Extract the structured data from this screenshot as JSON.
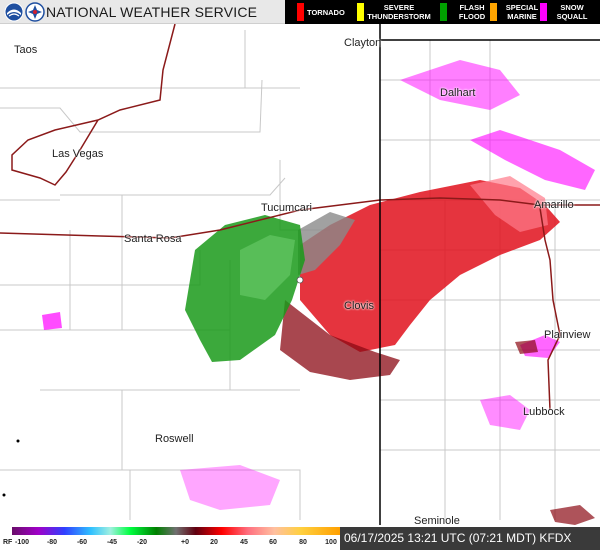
{
  "header": {
    "agency": "NATIONAL WEATHER SERVICE",
    "warnings": [
      {
        "label": "TORNADO",
        "color": "#ff0000"
      },
      {
        "label": "SEVERE THUNDERSTORM",
        "color": "#ffff00"
      },
      {
        "label": "FLASH FLOOD",
        "color": "#00a000"
      },
      {
        "label": "SPECIAL MARINE",
        "color": "#ffa500"
      },
      {
        "label": "SNOW SQUALL",
        "color": "#ff00ff"
      }
    ]
  },
  "cities": {
    "taos": "Taos",
    "clayton": "Clayton",
    "dalhart": "Dalhart",
    "las_vegas": "Las Vegas",
    "tucumcari": "Tucumcari",
    "amarillo": "Amarillo",
    "santa_rosa": "Santa Rosa",
    "clovis": "Clovis",
    "plainview": "Plainview",
    "lubbock": "Lubbock",
    "roswell": "Roswell",
    "seminole": "Seminole"
  },
  "scale": {
    "product": "RF",
    "ticks": [
      "-100",
      "-80",
      "-60",
      "-45",
      "-20",
      "+0",
      "20",
      "45",
      "60",
      "80",
      "100"
    ]
  },
  "timestamp": "06/17/2025 13:21 UTC (07:21 MDT) KFDX",
  "colors": {
    "inbound": "#00a000",
    "outbound": "#e0101c",
    "range_folded": "#ff00ff",
    "roads": "#8b1a1a",
    "state_border": "#000000",
    "county_lines": "#c8c8c8"
  }
}
